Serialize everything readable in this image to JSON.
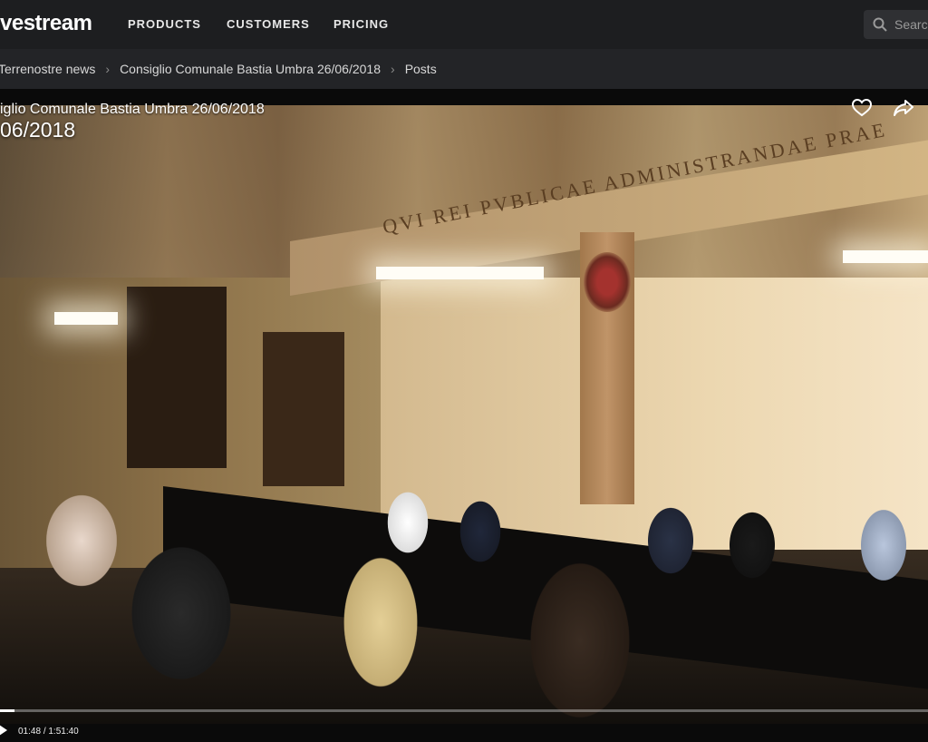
{
  "nav": {
    "logo": "vestream",
    "items": [
      "PRODUCTS",
      "CUSTOMERS",
      "PRICING"
    ],
    "search_placeholder": "Searc"
  },
  "breadcrumb": [
    "Terrenostre news",
    "Consiglio Comunale Bastia Umbra 26/06/2018",
    "Posts"
  ],
  "video": {
    "title": "iglio Comunale Bastia Umbra 26/06/2018",
    "date": "06/2018",
    "fresco_text": "QVI REI PVBLICAE ADMINISTRANDAE PRAE",
    "current_time": "01:48",
    "duration": "1:51:40",
    "progress_fraction": 0.016
  }
}
